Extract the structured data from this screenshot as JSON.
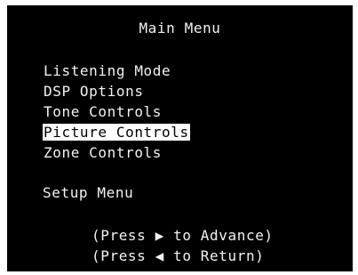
{
  "menu": {
    "title": "Main Menu",
    "items": [
      {
        "label": "Listening Mode",
        "selected": false
      },
      {
        "label": "DSP Options",
        "selected": false
      },
      {
        "label": "Tone Controls",
        "selected": false
      },
      {
        "label": "Picture Controls",
        "selected": true
      },
      {
        "label": "Zone Controls",
        "selected": false
      }
    ],
    "setup_label": "Setup Menu"
  },
  "hints": {
    "advance_prefix": "(Press ",
    "advance_glyph": "▶",
    "advance_suffix": " to Advance)",
    "return_prefix": "(Press ",
    "return_glyph": "◀",
    "return_suffix": " to Return)"
  },
  "colors": {
    "background": "#000000",
    "text": "#f2f2f2",
    "highlight_background": "#ffffff",
    "highlight_text": "#000000"
  }
}
